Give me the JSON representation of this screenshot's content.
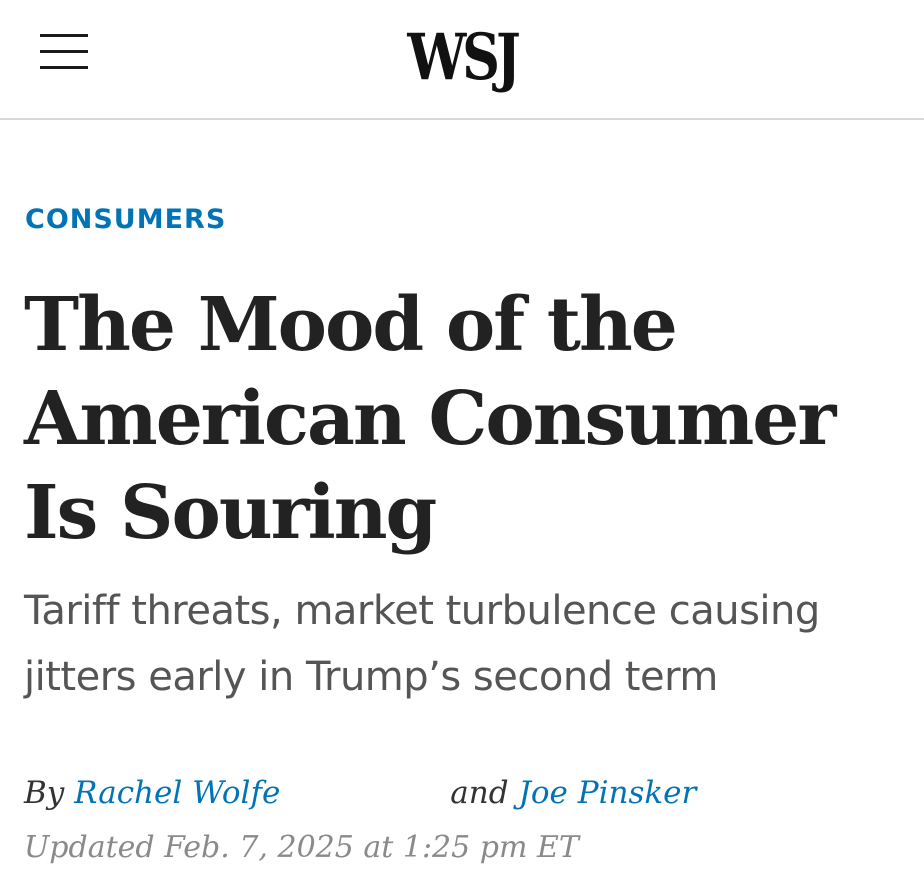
{
  "header": {
    "logo": "WSJ",
    "menu_icon": "hamburger-menu-icon"
  },
  "article": {
    "section": "CONSUMERS",
    "headline": "The Mood of the American Consumer Is Souring",
    "dek": "Tariff threats, market turbulence causing jitters early in Trump’s second term",
    "byline": {
      "prefix": "By",
      "author1": "Rachel Wolfe",
      "conjunction": "and",
      "author2": "Joe Pinsker"
    },
    "timestamp": "Updated Feb. 7, 2025 at 1:25 pm ET"
  },
  "colors": {
    "link_blue": "#0274b6",
    "headline": "#222222",
    "dek": "#555555",
    "timestamp": "#8a8a8a"
  }
}
